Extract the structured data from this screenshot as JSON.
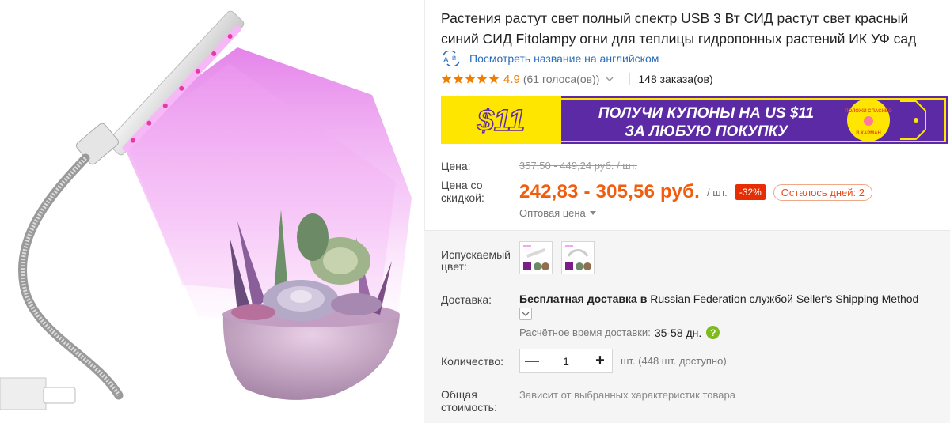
{
  "product": {
    "title": "Растения растут свет полный спектр USB 3 Вт СИД растут свет красный синий СИД Fitolampy огни для теплицы гидропонных растений ИК УФ сад",
    "translate_link": "Посмотреть название на английском",
    "rating": {
      "score": "4.9",
      "votes": "(61 голоса(ов))",
      "stars": 5
    },
    "orders": "148 заказа(ов)"
  },
  "banner": {
    "amount": "$11",
    "line1": "ПОЛУЧИ КУПОНЫ НА US $11",
    "line2": "ЗА ЛЮБУЮ ПОКУПКУ",
    "badge_top": "ПОЛОЖИ СПАСИБО",
    "badge_bottom": "В КАРМАН"
  },
  "price": {
    "label": "Цена:",
    "old": "357,50 - 449,24 руб. / шт.",
    "discount_label_1": "Цена со",
    "discount_label_2": "скидкой:",
    "current": "242,83 - 305,56 руб.",
    "unit": "/ шт.",
    "discount_badge": "-32%",
    "days_left": "Осталось дней: 2",
    "wholesale": "Оптовая цена"
  },
  "color": {
    "label_1": "Испускаемый",
    "label_2": "цвет:"
  },
  "shipping": {
    "label": "Доставка:",
    "free": "Бесплатная доставка в",
    "destination": "Russian Federation",
    "by": "службой",
    "method": "Seller's Shipping Method",
    "eta_label": "Расчётное время доставки:",
    "eta": "35-58 дн.",
    "help": "?"
  },
  "quantity": {
    "label": "Количество:",
    "value": "1",
    "minus": "—",
    "plus": "+",
    "available": "шт. (448 шт. доступно)"
  },
  "total": {
    "label_1": "Общая",
    "label_2": "стоимость:",
    "note": "Зависит от выбранных характеристик товара"
  },
  "colors": {
    "price": "#f25d0d",
    "link": "#2a6ebb",
    "banner_purple": "#5b2aa4",
    "banner_yellow": "#ffe600",
    "star": "#f07c00",
    "help_green": "#7fba1f"
  }
}
